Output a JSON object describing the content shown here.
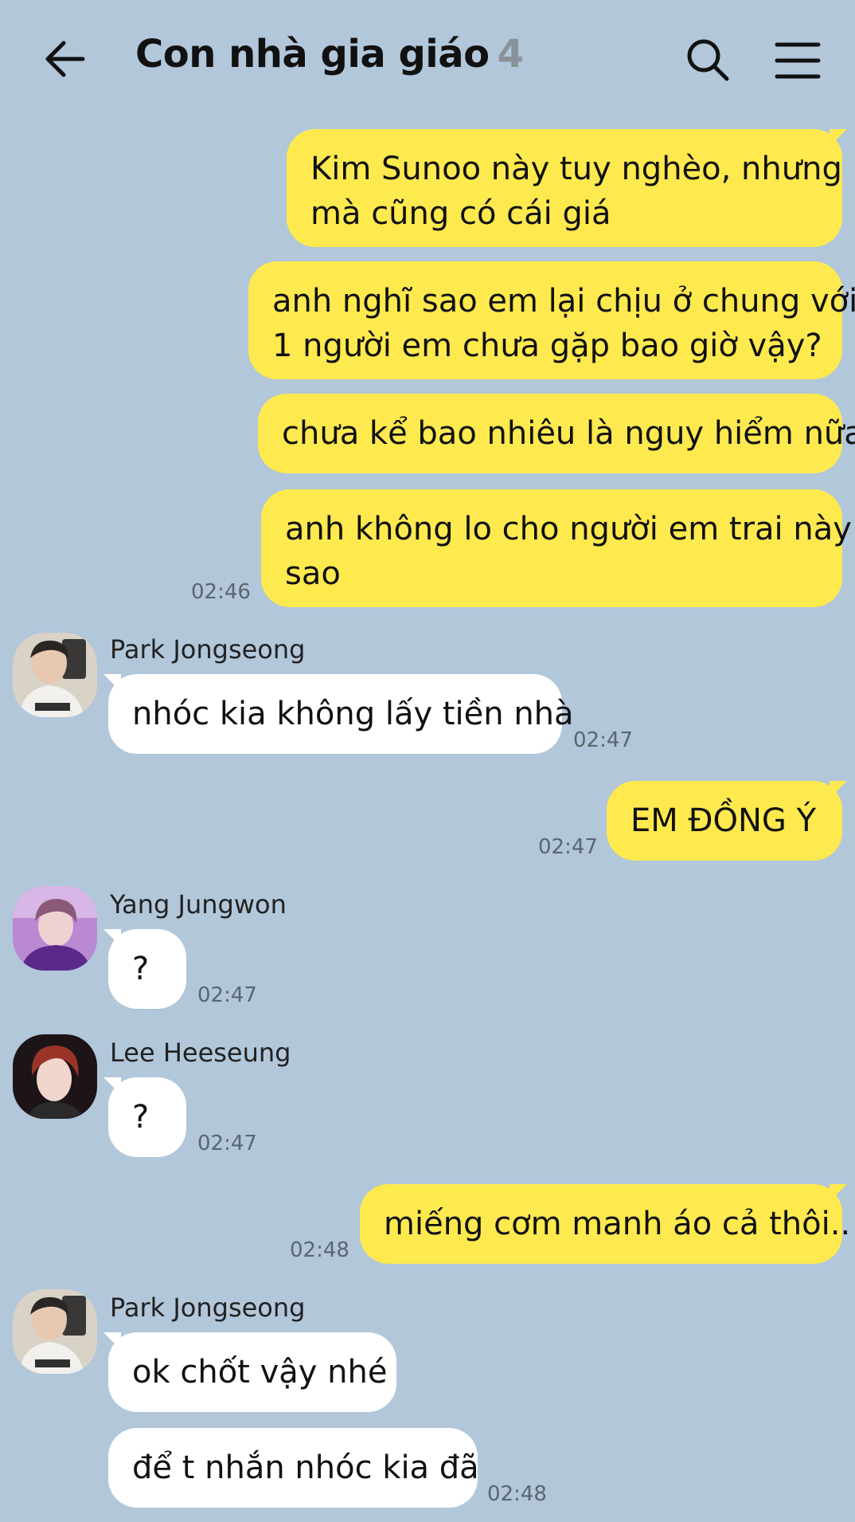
{
  "header": {
    "title": "Con nhà gia giáo",
    "member_count": "4",
    "back_icon": "arrow-left-icon",
    "search_icon": "search-icon",
    "menu_icon": "hamburger-menu-icon"
  },
  "colors": {
    "background": "#b2c7da",
    "my_bubble": "#fee94e",
    "their_bubble": "#ffffff",
    "time_text": "#5b6670",
    "count_text": "#8a9299"
  },
  "messages": [
    {
      "from": "me",
      "lines": [
        "Kim Sunoo này tuy nghèo, nhưng",
        "mà cũng có cái giá"
      ]
    },
    {
      "from": "me",
      "lines": [
        "anh nghĩ sao em lại chịu ở chung với",
        "1 người em chưa gặp bao giờ vậy?"
      ]
    },
    {
      "from": "me",
      "lines": [
        "chưa kể bao nhiêu là nguy hiểm nữa"
      ]
    },
    {
      "from": "me",
      "lines": [
        "anh không lo cho người em trai này",
        "sao"
      ],
      "time": "02:46"
    },
    {
      "from": "Park Jongseong",
      "lines": [
        "nhóc kia không lấy tiền nhà"
      ],
      "time": "02:47"
    },
    {
      "from": "me",
      "lines": [
        "EM ĐỒNG Ý"
      ],
      "time": "02:47"
    },
    {
      "from": "Yang Jungwon",
      "lines": [
        "?"
      ],
      "time": "02:47"
    },
    {
      "from": "Lee Heeseung",
      "lines": [
        "?"
      ],
      "time": "02:47"
    },
    {
      "from": "me",
      "lines": [
        "miếng cơm manh áo cả thôi.."
      ],
      "time": "02:48"
    },
    {
      "from": "Park Jongseong",
      "lines": [
        "ok chốt vậy nhé"
      ]
    },
    {
      "from": "Park Jongseong",
      "lines": [
        "để t nhắn nhóc kia đã"
      ],
      "time": "02:48"
    }
  ]
}
